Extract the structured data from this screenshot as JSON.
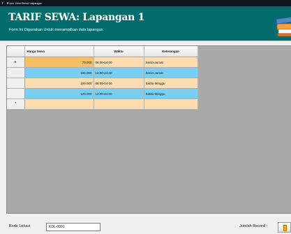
{
  "window": {
    "title": "Form View Detail Lapangan"
  },
  "header": {
    "title": "TARIF SEWA: Lapangan 1",
    "subtitle": "Form Ini Digunakan Untuk menampilkan data lapangan",
    "logo_icon": "books-stack-icon",
    "background_color": "#016c6b"
  },
  "grid": {
    "columns": [
      "Harga Sewa",
      "Waktu",
      "Keterangan"
    ],
    "rows": [
      {
        "harga": "70.000",
        "waktu": "08:00-14:00",
        "keterangan": "Senin-Jumat",
        "selected": true,
        "indicator": "▸"
      },
      {
        "harga": "100.000",
        "waktu": "14:00-24:00",
        "keterangan": "Senin-Jumat",
        "selected": false,
        "indicator": ""
      },
      {
        "harga": "100.000",
        "waktu": "08:00-14:00",
        "keterangan": "Sabtu-Minggu",
        "selected": false,
        "indicator": ""
      },
      {
        "harga": "120.000",
        "waktu": "14:00-24:00",
        "keterangan": "Sabtu-Minggu",
        "selected": false,
        "indicator": ""
      }
    ],
    "new_row_indicator": "*",
    "row_colors": {
      "orange": "#fddcaf",
      "blue": "#78cff2",
      "selected": "#f6be62"
    }
  },
  "footer": {
    "kode_label": "Kode Lokasi",
    "kode_value": "KDL-0001",
    "jumlah_label": "Jumlah Record :"
  }
}
